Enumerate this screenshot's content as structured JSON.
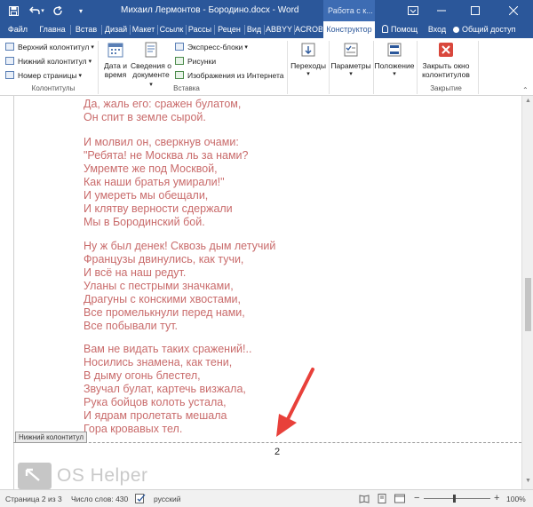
{
  "window": {
    "title": "Михаил Лермонтов - Бородино.docx - Word",
    "context_group": "Работа с к...",
    "accent_color": "#2b579a"
  },
  "quick_access": {
    "icons": [
      "save-icon",
      "undo-icon",
      "redo-icon",
      "customize-icon"
    ]
  },
  "tabs": [
    "Файл",
    "Главна",
    "Встав",
    "Дизай",
    "Макет",
    "Ссылк",
    "Рассы",
    "Рецен",
    "Вид",
    "ABBYY",
    "ACROB",
    "Конструктор"
  ],
  "active_tab": "Конструктор",
  "tell_me": "Помощ",
  "sign_in": "Вход",
  "share": "Общий доступ",
  "ribbon": {
    "headers_group": {
      "header_btn": "Верхний колонтитул",
      "footer_btn": "Нижний колонтитул",
      "pagenum_btn": "Номер страницы",
      "label": "Колонтитулы"
    },
    "insert_group": {
      "datetime_line1": "Дата и",
      "datetime_line2": "время",
      "docinfo_line1": "Сведения о",
      "docinfo_line2": "документе",
      "quickparts_btn": "Экспресс-блоки",
      "pictures_btn": "Рисунки",
      "online_pictures_btn": "Изображения из Интернета",
      "label": "Вставка"
    },
    "nav_btn": "Переходы",
    "params_btn": "Параметры",
    "position_btn": "Положение",
    "close_group": {
      "close_line1": "Закрыть окно",
      "close_line2": "колонтитулов",
      "label": "Закрытие"
    }
  },
  "document": {
    "lines": [
      "Да, жаль его: сражен булатом,",
      "Он спит в земле сырой.",
      "",
      "И молвил он, сверкнув очами:",
      "\"Ребята! не Москва ль за нами?",
      "Умремте же под Москвой,",
      "Как наши братья умирали!\"",
      "И умереть мы обещали,",
      "И клятву верности сдержали",
      "Мы в Бородинский бой.",
      "",
      "Ну ж был денек! Сквозь дым летучий",
      "Французы двинулись, как тучи,",
      "И всё на наш редут.",
      "Уланы с пестрыми значками,",
      "Драгуны с конскими хвостами,",
      "Все промелькнули перед нами,",
      "Все побывали тут.",
      "",
      "Вам не видать таких сражений!..",
      "Носились знамена, как тени,",
      "В дыму огонь блестел,",
      "Звучал булат, картечь визжала,",
      "Рука бойцов колоть устала,",
      "И ядрам пролетать мешала",
      "Гора кровавых тел."
    ],
    "footer_tag": "Нижний колонтитул",
    "page_number": "2",
    "text_color": "#c96b6b",
    "annotation_color": "#e8403a"
  },
  "watermark": "OS Helper",
  "status": {
    "page": "Страница 2 из 3",
    "words": "Число слов: 430",
    "language": "русский",
    "zoom": "100%",
    "zoom_level": 1.0
  }
}
